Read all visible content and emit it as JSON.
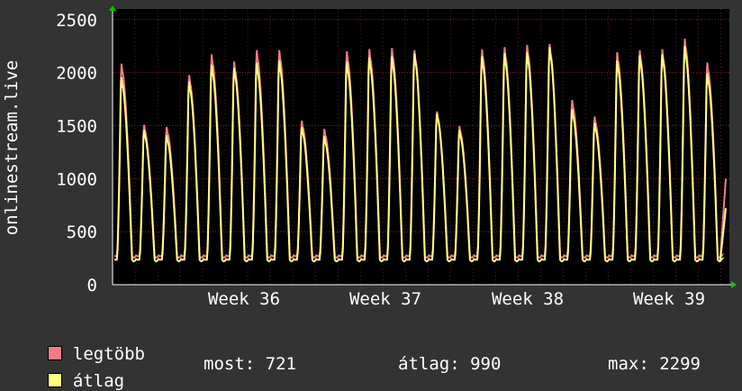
{
  "chart_data": {
    "type": "line",
    "ylabel": "onlinestream.live",
    "ylim": [
      0,
      2600
    ],
    "yticks": [
      0,
      500,
      1000,
      1500,
      2000,
      2500
    ],
    "xticks": [
      "Week 36",
      "Week 37",
      "Week 38",
      "Week 39"
    ],
    "grid": true,
    "colors": {
      "background": "#333333",
      "plot": "#000000",
      "legegtobb": "#f07c86",
      "atlag": "#ffff80",
      "grid": "#5a2020"
    },
    "series": [
      {
        "name": "legtöbb",
        "color": "#f07c86",
        "daily_peaks": [
          2130,
          1540,
          1520,
          2020,
          2220,
          2150,
          2260,
          2260,
          1580,
          1500,
          2250,
          2270,
          2280,
          2260,
          1670,
          1530,
          2270,
          2290,
          2310,
          2320,
          1780,
          1620,
          2240,
          2260,
          2270,
          2370,
          2140
        ],
        "last": 1000
      },
      {
        "name": "átlag",
        "color": "#ffff80",
        "daily_peaks": [
          2000,
          1490,
          1440,
          1960,
          2120,
          2090,
          2140,
          2160,
          1520,
          1430,
          2150,
          2190,
          2200,
          2230,
          1650,
          1490,
          2200,
          2230,
          2240,
          2290,
          1690,
          1560,
          2160,
          2210,
          2220,
          2299,
          2040
        ],
        "last": 721
      }
    ]
  },
  "legend": {
    "max_label": "legtöbb",
    "avg_label": "átlag",
    "now": "most: 721",
    "average": "átlag: 990",
    "maximum": "max: 2299"
  }
}
